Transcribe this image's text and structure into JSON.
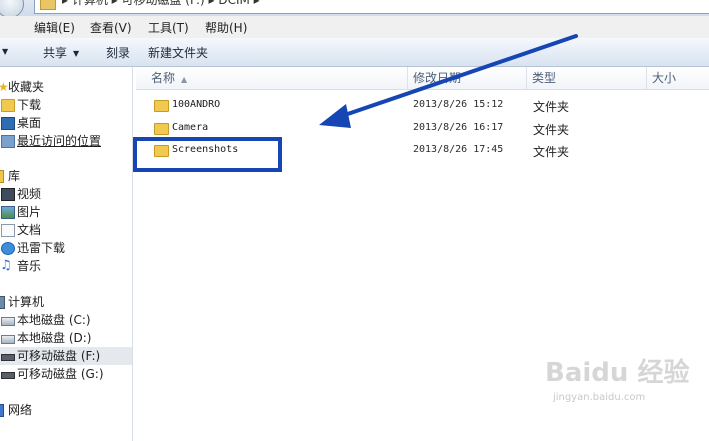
{
  "address_bar": {
    "path_text": "▸ 计算机 ▸ 可移动磁盘 (F:) ▸ DCIM ▸"
  },
  "menu": [
    {
      "label": "编辑(E)"
    },
    {
      "label": "查看(V)"
    },
    {
      "label": "工具(T)"
    },
    {
      "label": "帮助(H)"
    }
  ],
  "toolbar": [
    {
      "label": "共享",
      "dropdown": true
    },
    {
      "label": "刻录",
      "dropdown": false
    },
    {
      "label": "新建文件夹",
      "dropdown": false
    }
  ],
  "nav": {
    "favorites_header": "收藏夹",
    "favorites": [
      {
        "label": "下载",
        "icon": "download-folder-icon"
      },
      {
        "label": "桌面",
        "icon": "desktop-icon"
      },
      {
        "label": "最近访问的位置",
        "icon": "recent-places-icon"
      }
    ],
    "libraries_header": "库",
    "libraries": [
      {
        "label": "视频",
        "icon": "video-library-icon"
      },
      {
        "label": "图片",
        "icon": "pictures-library-icon"
      },
      {
        "label": "文档",
        "icon": "documents-library-icon"
      },
      {
        "label": "迅雷下载",
        "icon": "thunder-download-icon"
      },
      {
        "label": "音乐",
        "icon": "music-library-icon"
      }
    ],
    "computer_header": "计算机",
    "drives": [
      {
        "label": "本地磁盘 (C:)",
        "icon": "local-disk-icon"
      },
      {
        "label": "本地磁盘 (D:)",
        "icon": "local-disk-icon"
      },
      {
        "label": "可移动磁盘 (F:)",
        "icon": "removable-disk-icon",
        "selected": true
      },
      {
        "label": "可移动磁盘 (G:)",
        "icon": "removable-disk-icon"
      }
    ],
    "network_header": "网络"
  },
  "columns": {
    "name": "名称",
    "modified": "修改日期",
    "type": "类型",
    "size": "大小"
  },
  "files": [
    {
      "name": "100ANDRO",
      "modified": "2013/8/26 15:12",
      "type": "文件夹"
    },
    {
      "name": "Camera",
      "modified": "2013/8/26 16:17",
      "type": "文件夹"
    },
    {
      "name": "Screenshots",
      "modified": "2013/8/26 17:45",
      "type": "文件夹"
    }
  ],
  "annotation": {
    "color": "#1546b4"
  },
  "watermark": {
    "logo": "Baidu 经验",
    "url": "jingyan.baidu.com"
  }
}
